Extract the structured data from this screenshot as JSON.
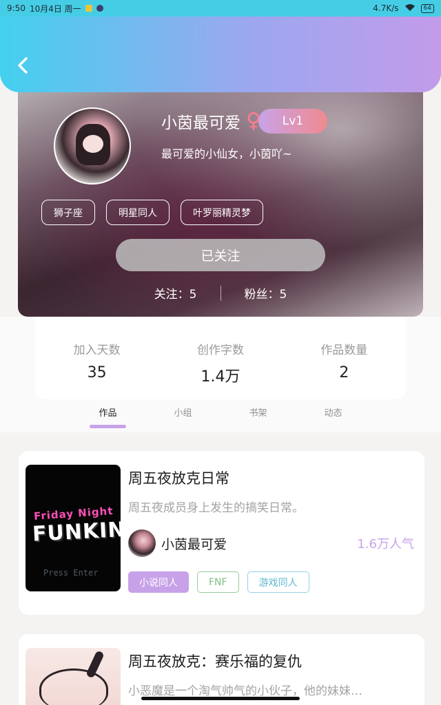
{
  "status_bar": {
    "time": "9:50",
    "date": "10月4日 周一",
    "speed": "4.7K/s",
    "battery": "64"
  },
  "profile": {
    "name": "小茵最可爱",
    "gender_symbol": "♀",
    "level": "Lv1",
    "bio": "最可爱的小仙女，小茵吖~",
    "tags": [
      "狮子座",
      "明星同人",
      "叶罗丽精灵梦"
    ],
    "follow_button": "已关注",
    "following": "关注：5",
    "followers": "粉丝：5"
  },
  "stats": [
    {
      "label": "加入天数",
      "value": "35"
    },
    {
      "label": "创作字数",
      "value": "1.4万"
    },
    {
      "label": "作品数量",
      "value": "2"
    }
  ],
  "tabs": [
    {
      "label": "作品",
      "active": true
    },
    {
      "label": "小组",
      "active": false
    },
    {
      "label": "书架",
      "active": false
    },
    {
      "label": "动态",
      "active": false
    }
  ],
  "works": [
    {
      "title": "周五夜放克日常",
      "description": "周五夜成员身上发生的搞笑日常。",
      "author": "小茵最可爱",
      "popularity": "1.6万人气",
      "cover_text": [
        "Friday Night",
        "FUNKIN'",
        "Press Enter"
      ],
      "tags": [
        "小说同人",
        "FNF",
        "游戏同人"
      ]
    },
    {
      "title": "周五夜放克：赛乐福的复仇",
      "description": "小恶魔是一个淘气帅气的小伙子，他的妹妹…"
    }
  ],
  "colors": {
    "accent_purple": "#c7a2e9",
    "header_start": "#43d0ef",
    "header_end": "#c39bea"
  }
}
